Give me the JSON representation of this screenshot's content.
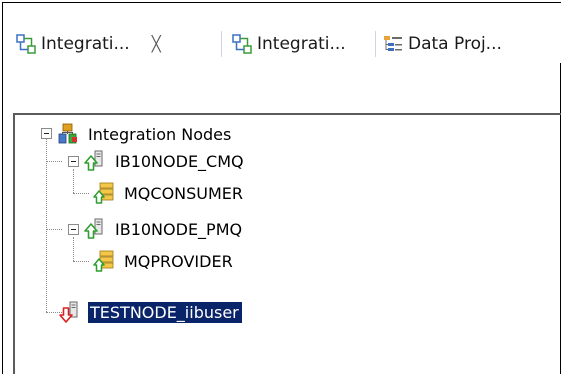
{
  "tabs": [
    {
      "label": "Integrati...",
      "icon": "integration-explorer-icon",
      "active": true,
      "close_glyph": "╳"
    },
    {
      "label": "Integrati...",
      "icon": "integration-explorer-icon",
      "active": false
    },
    {
      "label": "Data Proj...",
      "icon": "data-project-icon",
      "active": false
    }
  ],
  "tree": {
    "root": {
      "label": "Integration Nodes",
      "icon": "integration-nodes-folder-icon",
      "expanded": true
    },
    "nodes": [
      {
        "label": "IB10NODE_CMQ",
        "icon": "node-running-icon",
        "status": "running",
        "expanded": true,
        "children": [
          {
            "label": "MQCONSUMER",
            "icon": "integration-server-icon"
          }
        ]
      },
      {
        "label": "IB10NODE_PMQ",
        "icon": "node-running-icon",
        "status": "running",
        "expanded": true,
        "children": [
          {
            "label": "MQPROVIDER",
            "icon": "integration-server-icon"
          }
        ]
      },
      {
        "label": "TESTNODE_iibuser",
        "icon": "node-stopped-icon",
        "status": "stopped",
        "selected": true
      }
    ]
  },
  "colors": {
    "running_arrow": "#2f9d2f",
    "stopped_arrow": "#d92020",
    "selection_bg": "#0a246a",
    "selection_fg": "#ffffff"
  }
}
